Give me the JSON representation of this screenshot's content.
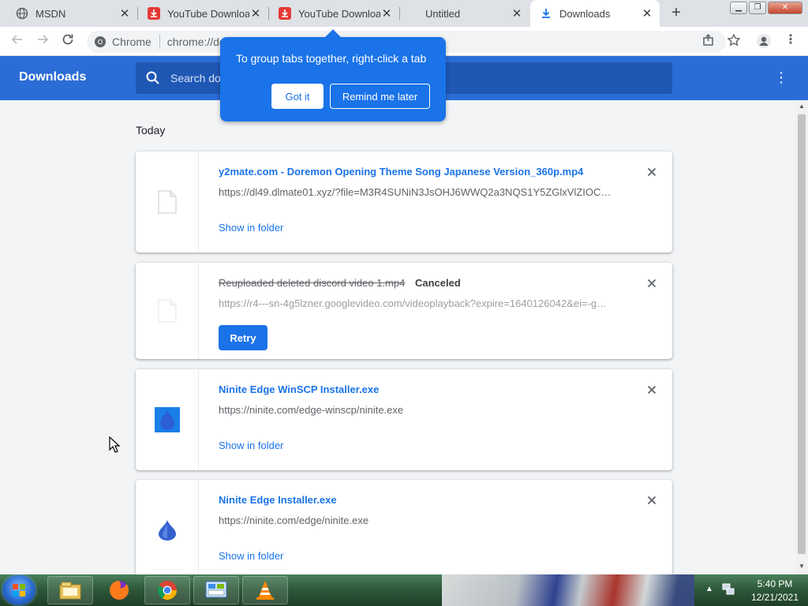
{
  "tabs": [
    {
      "title": "MSDN",
      "icon": "globe-icon",
      "active": false
    },
    {
      "title": "YouTube Downloader",
      "icon": "youtube-downloader-icon",
      "active": false
    },
    {
      "title": "YouTube Downloader",
      "icon": "youtube-downloader-icon",
      "active": false
    },
    {
      "title": "Untitled",
      "icon": "",
      "active": false
    },
    {
      "title": "Downloads",
      "icon": "download-icon",
      "active": true
    }
  ],
  "toolbar": {
    "chip_label": "Chrome",
    "url": "chrome://downloads"
  },
  "header": {
    "title": "Downloads",
    "search_placeholder": "Search downloads"
  },
  "bubble": {
    "text": "To group tabs together, right-click a tab",
    "got_it": "Got it",
    "remind_later": "Remind me later"
  },
  "section_label": "Today",
  "downloads": [
    {
      "name": "y2mate.com - Doremon Opening Theme Song Japanese Version_360p.mp4",
      "url": "https://dl49.dlmate01.xyz/?file=M3R4SUNiN3JsOHJ6WWQ2a3NQS1Y5ZGlxVlZIOCty...",
      "action": "Show in folder",
      "status": "",
      "icon": "file-icon"
    },
    {
      "name": "Reuploaded deleted discord video 1.mp4",
      "url": "https://r4---sn-4g5lzner.googlevideo.com/videoplayback?expire=1640126042&ei=-gH...",
      "action": "Retry",
      "status": "Canceled",
      "icon": "file-icon"
    },
    {
      "name": "Ninite Edge WinSCP Installer.exe",
      "url": "https://ninite.com/edge-winscp/ninite.exe",
      "action": "Show in folder",
      "status": "",
      "icon": "ninite-winscp-icon"
    },
    {
      "name": "Ninite Edge Installer.exe",
      "url": "https://ninite.com/edge/ninite.exe",
      "action": "Show in folder",
      "status": "",
      "icon": "ninite-icon"
    }
  ],
  "taskbar": {
    "time": "5:40 PM",
    "date": "12/21/2021",
    "apps": [
      "file-explorer-icon",
      "firefox-icon",
      "chrome-icon",
      "control-panel-icon",
      "vlc-icon"
    ]
  },
  "colors": {
    "accent": "#1a73e8",
    "header_bg": "#2b6dd6",
    "search_bg": "#1f57b5"
  }
}
